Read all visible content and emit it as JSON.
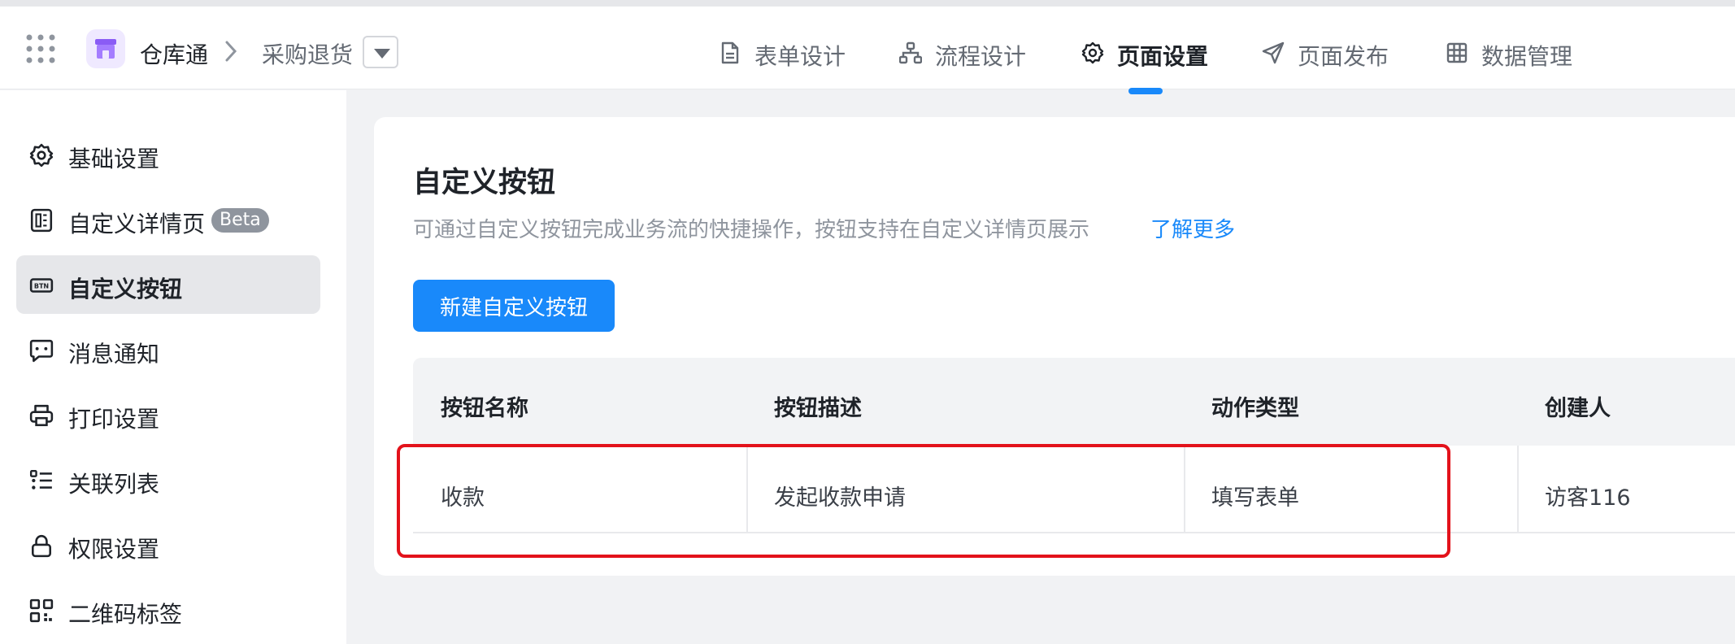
{
  "header": {
    "app_name": "仓库通",
    "current_page": "采购退货",
    "tabs": [
      {
        "label": "表单设计",
        "icon": "form-doc-icon",
        "active": false
      },
      {
        "label": "流程设计",
        "icon": "flow-icon",
        "active": false
      },
      {
        "label": "页面设置",
        "icon": "gear-icon",
        "active": true
      },
      {
        "label": "页面发布",
        "icon": "send-icon",
        "active": false
      },
      {
        "label": "数据管理",
        "icon": "grid-table-icon",
        "active": false
      }
    ]
  },
  "sidebar": {
    "items": [
      {
        "label": "基础设置",
        "icon": "gear-icon",
        "active": false
      },
      {
        "label": "自定义详情页",
        "icon": "detail-page-icon",
        "active": false,
        "badge": "Beta"
      },
      {
        "label": "自定义按钮",
        "icon": "btn-icon",
        "active": true
      },
      {
        "label": "消息通知",
        "icon": "message-icon",
        "active": false
      },
      {
        "label": "打印设置",
        "icon": "printer-icon",
        "active": false
      },
      {
        "label": "关联列表",
        "icon": "list-icon",
        "active": false
      },
      {
        "label": "权限设置",
        "icon": "lock-icon",
        "active": false
      },
      {
        "label": "二维码标签",
        "icon": "qrcode-icon",
        "active": false
      }
    ]
  },
  "main": {
    "title": "自定义按钮",
    "description": "可通过自定义按钮完成业务流的快捷操作，按钮支持在自定义详情页展示",
    "learn_more": "了解更多",
    "new_button_label": "新建自定义按钮",
    "table": {
      "columns": [
        "按钮名称",
        "按钮描述",
        "动作类型",
        "创建人"
      ],
      "rows": [
        [
          "收款",
          "发起收款申请",
          "填写表单",
          "访客116"
        ]
      ]
    }
  },
  "colors": {
    "accent": "#1989fa",
    "highlight": "#e3121b",
    "logo_purple": "#8a5cf5"
  }
}
